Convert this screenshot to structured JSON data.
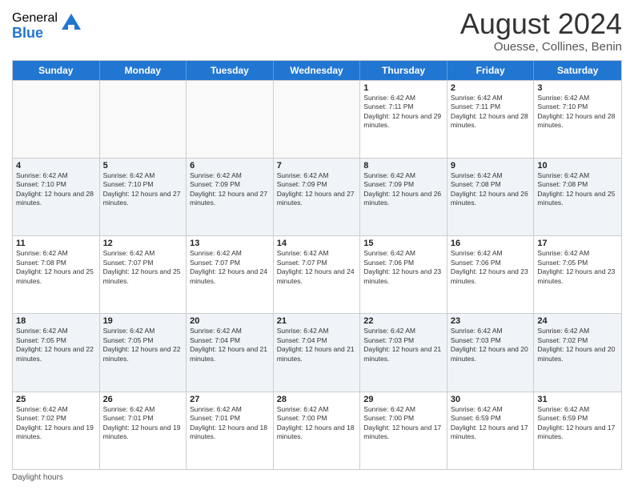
{
  "logo": {
    "general": "General",
    "blue": "Blue"
  },
  "header": {
    "title": "August 2024",
    "subtitle": "Ouesse, Collines, Benin"
  },
  "days": [
    "Sunday",
    "Monday",
    "Tuesday",
    "Wednesday",
    "Thursday",
    "Friday",
    "Saturday"
  ],
  "footer": {
    "daylight_label": "Daylight hours"
  },
  "weeks": [
    [
      {
        "day": "",
        "sunrise": "",
        "sunset": "",
        "daylight": "",
        "empty": true
      },
      {
        "day": "",
        "sunrise": "",
        "sunset": "",
        "daylight": "",
        "empty": true
      },
      {
        "day": "",
        "sunrise": "",
        "sunset": "",
        "daylight": "",
        "empty": true
      },
      {
        "day": "",
        "sunrise": "",
        "sunset": "",
        "daylight": "",
        "empty": true
      },
      {
        "day": "1",
        "sunrise": "Sunrise: 6:42 AM",
        "sunset": "Sunset: 7:11 PM",
        "daylight": "Daylight: 12 hours and 29 minutes.",
        "empty": false
      },
      {
        "day": "2",
        "sunrise": "Sunrise: 6:42 AM",
        "sunset": "Sunset: 7:11 PM",
        "daylight": "Daylight: 12 hours and 28 minutes.",
        "empty": false
      },
      {
        "day": "3",
        "sunrise": "Sunrise: 6:42 AM",
        "sunset": "Sunset: 7:10 PM",
        "daylight": "Daylight: 12 hours and 28 minutes.",
        "empty": false
      }
    ],
    [
      {
        "day": "4",
        "sunrise": "Sunrise: 6:42 AM",
        "sunset": "Sunset: 7:10 PM",
        "daylight": "Daylight: 12 hours and 28 minutes.",
        "empty": false
      },
      {
        "day": "5",
        "sunrise": "Sunrise: 6:42 AM",
        "sunset": "Sunset: 7:10 PM",
        "daylight": "Daylight: 12 hours and 27 minutes.",
        "empty": false
      },
      {
        "day": "6",
        "sunrise": "Sunrise: 6:42 AM",
        "sunset": "Sunset: 7:09 PM",
        "daylight": "Daylight: 12 hours and 27 minutes.",
        "empty": false
      },
      {
        "day": "7",
        "sunrise": "Sunrise: 6:42 AM",
        "sunset": "Sunset: 7:09 PM",
        "daylight": "Daylight: 12 hours and 27 minutes.",
        "empty": false
      },
      {
        "day": "8",
        "sunrise": "Sunrise: 6:42 AM",
        "sunset": "Sunset: 7:09 PM",
        "daylight": "Daylight: 12 hours and 26 minutes.",
        "empty": false
      },
      {
        "day": "9",
        "sunrise": "Sunrise: 6:42 AM",
        "sunset": "Sunset: 7:08 PM",
        "daylight": "Daylight: 12 hours and 26 minutes.",
        "empty": false
      },
      {
        "day": "10",
        "sunrise": "Sunrise: 6:42 AM",
        "sunset": "Sunset: 7:08 PM",
        "daylight": "Daylight: 12 hours and 25 minutes.",
        "empty": false
      }
    ],
    [
      {
        "day": "11",
        "sunrise": "Sunrise: 6:42 AM",
        "sunset": "Sunset: 7:08 PM",
        "daylight": "Daylight: 12 hours and 25 minutes.",
        "empty": false
      },
      {
        "day": "12",
        "sunrise": "Sunrise: 6:42 AM",
        "sunset": "Sunset: 7:07 PM",
        "daylight": "Daylight: 12 hours and 25 minutes.",
        "empty": false
      },
      {
        "day": "13",
        "sunrise": "Sunrise: 6:42 AM",
        "sunset": "Sunset: 7:07 PM",
        "daylight": "Daylight: 12 hours and 24 minutes.",
        "empty": false
      },
      {
        "day": "14",
        "sunrise": "Sunrise: 6:42 AM",
        "sunset": "Sunset: 7:07 PM",
        "daylight": "Daylight: 12 hours and 24 minutes.",
        "empty": false
      },
      {
        "day": "15",
        "sunrise": "Sunrise: 6:42 AM",
        "sunset": "Sunset: 7:06 PM",
        "daylight": "Daylight: 12 hours and 23 minutes.",
        "empty": false
      },
      {
        "day": "16",
        "sunrise": "Sunrise: 6:42 AM",
        "sunset": "Sunset: 7:06 PM",
        "daylight": "Daylight: 12 hours and 23 minutes.",
        "empty": false
      },
      {
        "day": "17",
        "sunrise": "Sunrise: 6:42 AM",
        "sunset": "Sunset: 7:05 PM",
        "daylight": "Daylight: 12 hours and 23 minutes.",
        "empty": false
      }
    ],
    [
      {
        "day": "18",
        "sunrise": "Sunrise: 6:42 AM",
        "sunset": "Sunset: 7:05 PM",
        "daylight": "Daylight: 12 hours and 22 minutes.",
        "empty": false
      },
      {
        "day": "19",
        "sunrise": "Sunrise: 6:42 AM",
        "sunset": "Sunset: 7:05 PM",
        "daylight": "Daylight: 12 hours and 22 minutes.",
        "empty": false
      },
      {
        "day": "20",
        "sunrise": "Sunrise: 6:42 AM",
        "sunset": "Sunset: 7:04 PM",
        "daylight": "Daylight: 12 hours and 21 minutes.",
        "empty": false
      },
      {
        "day": "21",
        "sunrise": "Sunrise: 6:42 AM",
        "sunset": "Sunset: 7:04 PM",
        "daylight": "Daylight: 12 hours and 21 minutes.",
        "empty": false
      },
      {
        "day": "22",
        "sunrise": "Sunrise: 6:42 AM",
        "sunset": "Sunset: 7:03 PM",
        "daylight": "Daylight: 12 hours and 21 minutes.",
        "empty": false
      },
      {
        "day": "23",
        "sunrise": "Sunrise: 6:42 AM",
        "sunset": "Sunset: 7:03 PM",
        "daylight": "Daylight: 12 hours and 20 minutes.",
        "empty": false
      },
      {
        "day": "24",
        "sunrise": "Sunrise: 6:42 AM",
        "sunset": "Sunset: 7:02 PM",
        "daylight": "Daylight: 12 hours and 20 minutes.",
        "empty": false
      }
    ],
    [
      {
        "day": "25",
        "sunrise": "Sunrise: 6:42 AM",
        "sunset": "Sunset: 7:02 PM",
        "daylight": "Daylight: 12 hours and 19 minutes.",
        "empty": false
      },
      {
        "day": "26",
        "sunrise": "Sunrise: 6:42 AM",
        "sunset": "Sunset: 7:01 PM",
        "daylight": "Daylight: 12 hours and 19 minutes.",
        "empty": false
      },
      {
        "day": "27",
        "sunrise": "Sunrise: 6:42 AM",
        "sunset": "Sunset: 7:01 PM",
        "daylight": "Daylight: 12 hours and 18 minutes.",
        "empty": false
      },
      {
        "day": "28",
        "sunrise": "Sunrise: 6:42 AM",
        "sunset": "Sunset: 7:00 PM",
        "daylight": "Daylight: 12 hours and 18 minutes.",
        "empty": false
      },
      {
        "day": "29",
        "sunrise": "Sunrise: 6:42 AM",
        "sunset": "Sunset: 7:00 PM",
        "daylight": "Daylight: 12 hours and 17 minutes.",
        "empty": false
      },
      {
        "day": "30",
        "sunrise": "Sunrise: 6:42 AM",
        "sunset": "Sunset: 6:59 PM",
        "daylight": "Daylight: 12 hours and 17 minutes.",
        "empty": false
      },
      {
        "day": "31",
        "sunrise": "Sunrise: 6:42 AM",
        "sunset": "Sunset: 6:59 PM",
        "daylight": "Daylight: 12 hours and 17 minutes.",
        "empty": false
      }
    ]
  ]
}
